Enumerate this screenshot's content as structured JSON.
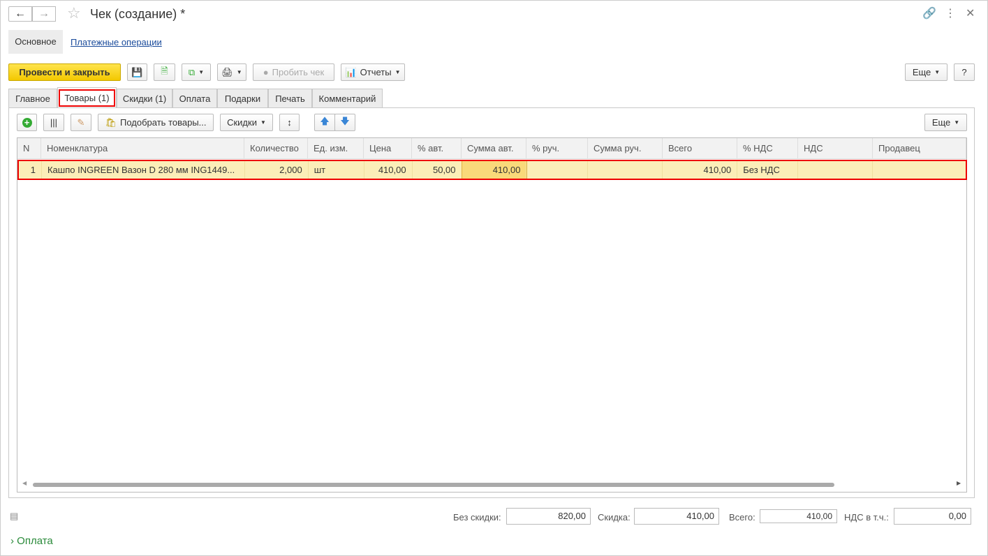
{
  "window": {
    "title": "Чек (создание) *"
  },
  "nav": {
    "main": "Основное",
    "payments": "Платежные операции"
  },
  "toolbar": {
    "post_close": "Провести и закрыть",
    "print_receipt": "Пробить чек",
    "reports": "Отчеты",
    "more": "Еще",
    "help": "?"
  },
  "tabs": [
    "Главное",
    "Товары (1)",
    "Скидки (1)",
    "Оплата",
    "Подарки",
    "Печать",
    "Комментарий"
  ],
  "goods_toolbar": {
    "pick": "Подобрать товары...",
    "discounts": "Скидки",
    "more": "Еще"
  },
  "table": {
    "columns": [
      "N",
      "Номенклатура",
      "Количество",
      "Ед. изм.",
      "Цена",
      "% авт.",
      "Сумма авт.",
      "% руч.",
      "Сумма руч.",
      "Всего",
      "% НДС",
      "НДС",
      "Продавец"
    ],
    "rows": [
      [
        "1",
        "Кашпо INGREEN Вазон D 280 мм ING1449...",
        "2,000",
        "шт",
        "410,00",
        "50,00",
        "410,00",
        "",
        "",
        "410,00",
        "Без НДС",
        "",
        ""
      ]
    ]
  },
  "totals": {
    "no_discount_label": "Без скидки:",
    "no_discount": "820,00",
    "discount_label": "Скидка:",
    "discount": "410,00",
    "total_label": "Всего:",
    "total": "410,00",
    "vat_label": "НДС в т.ч.:",
    "vat": "0,00"
  },
  "footer": {
    "payment": "Оплата"
  }
}
